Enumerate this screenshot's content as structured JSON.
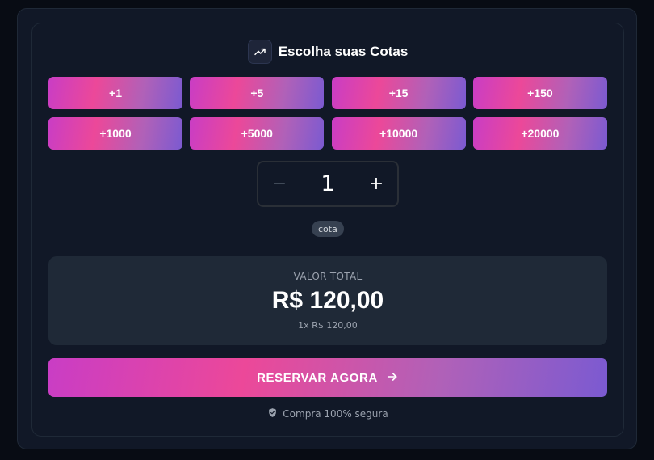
{
  "header": {
    "title": "Escolha suas Cotas",
    "icon": "trending-up-icon"
  },
  "quick_add": [
    "+1",
    "+5",
    "+15",
    "+150",
    "+1000",
    "+5000",
    "+10000",
    "+20000"
  ],
  "stepper": {
    "value": "1",
    "minus": "−",
    "plus": "+"
  },
  "unit_label": "cota",
  "total": {
    "label": "VALOR TOTAL",
    "value": "R$ 120,00",
    "detail": "1x R$ 120,00"
  },
  "reserve_button": {
    "label": "RESERVAR AGORA",
    "icon": "arrow-right-icon"
  },
  "secure_note": {
    "text": "Compra 100% segura",
    "icon": "shield-check-icon"
  },
  "colors": {
    "background": "#080c14",
    "card": "#111827",
    "gradient_start": "#c93dc5",
    "gradient_mid": "#ec4899",
    "gradient_end": "#7b5ad1"
  }
}
